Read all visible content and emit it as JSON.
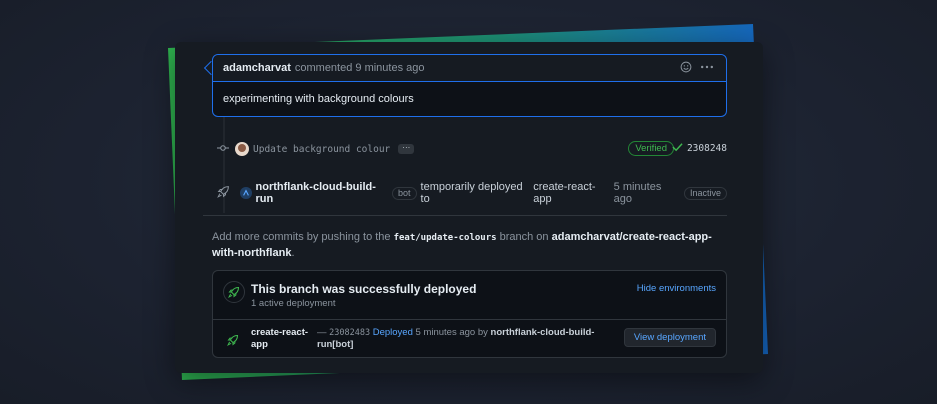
{
  "comment": {
    "author": "adamcharvat",
    "meta": "commented 9 minutes ago",
    "body": "experimenting with background colours",
    "emoji_icon": "smiley-icon",
    "more_icon": "kebab-horizontal-icon"
  },
  "commit": {
    "message": "Update background colour",
    "ellipsis": "···",
    "verified": "Verified",
    "sha": "2308248"
  },
  "deploy_event": {
    "actor": "northflank-cloud-build-run",
    "bot_label": "bot",
    "action": "temporarily deployed to",
    "environment": "create-react-app",
    "time": "5 minutes ago",
    "status": "Inactive"
  },
  "hint": {
    "prefix": "Add more commits by pushing to the",
    "branch": "feat/update-colours",
    "middle": "branch on",
    "repo": "adamcharvat/create-react-app-with-northflank",
    "suffix": "."
  },
  "deployment": {
    "title": "This branch was successfully deployed",
    "subtitle": "1 active deployment",
    "hide_label": "Hide environments",
    "env_name": "create-react-app",
    "dash": "—",
    "sha": "23082483",
    "status_link": "Deployed",
    "time": "5 minutes ago by",
    "actor": "northflank-cloud-build-run[bot]",
    "view_label": "View deployment"
  },
  "colors": {
    "green": "#2fb34f",
    "blue": "#1f6feb",
    "link": "#58a6ff"
  }
}
